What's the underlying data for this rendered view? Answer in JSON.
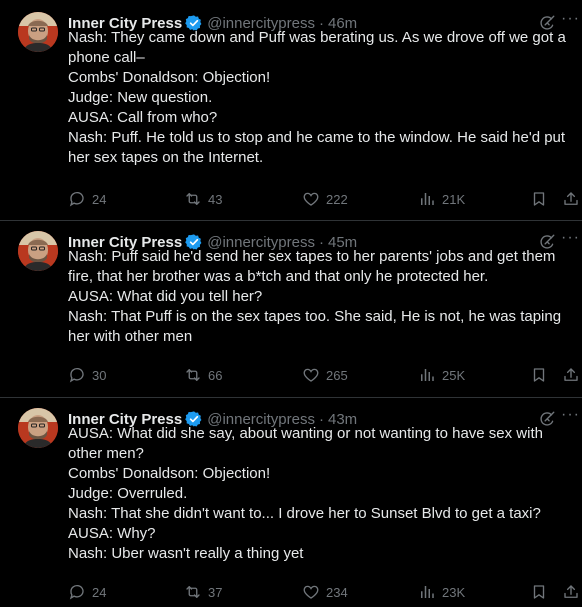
{
  "tweets": [
    {
      "name": "Inner City Press",
      "handle": "@innercitypress",
      "separator": "·",
      "time": "46m",
      "lines": [
        "Nash: They came down and Puff was berating us. As we drove off we got a",
        "phone call–",
        "Combs' Donaldson: Objection!",
        "Judge: New question.",
        "AUSA: Call from who?",
        "Nash: Puff. He told us to stop and he came to the window. He said he'd put",
        "her sex tapes on the Internet."
      ],
      "replies": "24",
      "reposts": "43",
      "likes": "222",
      "views": "21K"
    },
    {
      "name": "Inner City Press",
      "handle": "@innercitypress",
      "separator": "·",
      "time": "45m",
      "lines": [
        "Nash: Puff said he'd send her sex tapes to her parents' jobs and get them",
        "fire, that her brother was a b*tch and that only he protected her.",
        "AUSA: What did you tell her?",
        "Nash: That Puff is on the sex tapes too. She said, He is not, he was taping",
        "her with other men"
      ],
      "replies": "30",
      "reposts": "66",
      "likes": "265",
      "views": "25K"
    },
    {
      "name": "Inner City Press",
      "handle": "@innercitypress",
      "separator": "·",
      "time": "43m",
      "lines": [
        "AUSA: What did she say, about wanting or not wanting to have sex with",
        "other men?",
        "Combs' Donaldson: Objection!",
        "Judge: Overruled.",
        "Nash: That she didn't want to... I drove her to Sunset Blvd to get a taxi?",
        "AUSA: Why?",
        "Nash: Uber wasn't really a thing yet"
      ],
      "replies": "24",
      "reposts": "37",
      "likes": "234",
      "views": "23K"
    }
  ],
  "colors": {
    "background": "#000000",
    "text": "#e7e9ea",
    "muted": "#71767b",
    "verified": "#1d9bf0",
    "divider": "#2f3336"
  },
  "icons": [
    "avatar",
    "verified-badge-icon",
    "grok-icon",
    "more-icon",
    "reply-icon",
    "repost-icon",
    "like-icon",
    "views-icon",
    "bookmark-icon",
    "share-icon"
  ]
}
